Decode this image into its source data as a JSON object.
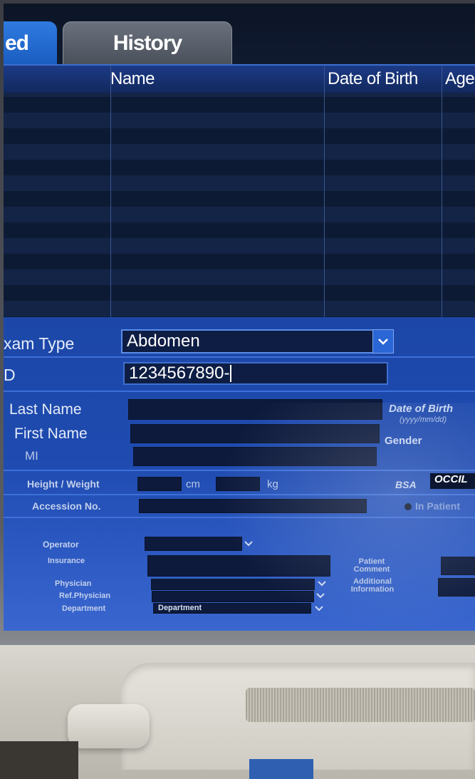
{
  "tabs": [
    {
      "label": "ed"
    },
    {
      "label": "History"
    }
  ],
  "list_columns": [
    "Name",
    "Date of Birth",
    "Age"
  ],
  "exam": {
    "label": "xam Type",
    "value": "Abdomen"
  },
  "id_field": {
    "label": "D",
    "value": "1234567890-"
  },
  "patient": {
    "last_name_label": "Last Name",
    "first_name_label": "First Name",
    "mi_label": "MI",
    "dob_label": "Date of Birth",
    "dob_format": "(yyyy/mm/dd)",
    "gender_label": "Gender"
  },
  "measure": {
    "label": "Height / Weight",
    "height_unit": "cm",
    "weight_unit": "kg",
    "bsa_label": "BSA",
    "bsa_value": "OCCIL"
  },
  "accession": {
    "label": "Accession No.",
    "in_patient_label": "In Patient"
  },
  "staff": {
    "operator_label": "Operator",
    "insurance_label": "Insurance",
    "physician_label": "Physician",
    "ref_physician_label": "Ref.Physician",
    "department_label": "Department",
    "department_value": "Department",
    "patient_comment_label": "Patient Comment",
    "additional_info_label": "Additional Information"
  },
  "colors": {
    "accent": "#2f7be0",
    "form_bg": "#1f4bb0",
    "list_bg": "#0d1a33"
  }
}
